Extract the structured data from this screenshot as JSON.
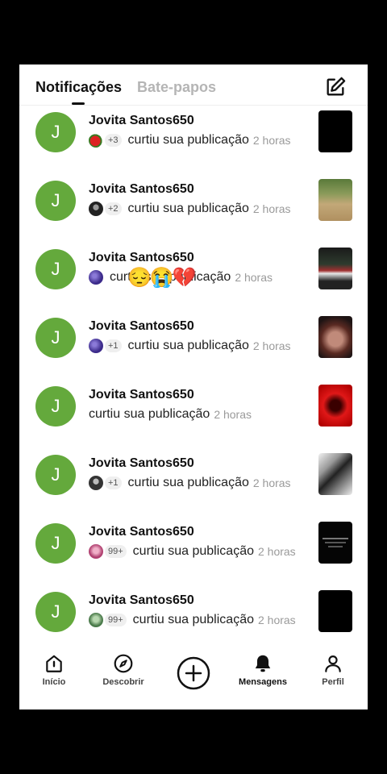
{
  "tabs": {
    "notifications": "Notificações",
    "chats": "Bate-papos"
  },
  "notifications": [
    {
      "name": "Jovita Santos650",
      "count": "+3",
      "action": "curtiu sua publicação",
      "time": "2 horas",
      "mini": "strawberry",
      "thumb": "#000000"
    },
    {
      "name": "Jovita Santos650",
      "count": "+2",
      "action": "curtiu sua publicação",
      "time": "2 horas",
      "mini": "dark-avatar",
      "thumb": "#9b8a5e"
    },
    {
      "name": "Jovita Santos650",
      "count": "",
      "action": "curtiu sua publicação",
      "time": "2 horas",
      "mini": "purple-avatar",
      "thumb": "#2a2a2a"
    },
    {
      "name": "Jovita Santos650",
      "count": "+1",
      "action": "curtiu sua publicação",
      "time": "2 horas",
      "mini": "purple-avatar",
      "thumb": "#4a2f2a"
    },
    {
      "name": "Jovita Santos650",
      "count": "",
      "action": "curtiu sua publicação",
      "time": "2 horas",
      "mini": "",
      "thumb": "#d81010"
    },
    {
      "name": "Jovita Santos650",
      "count": "+1",
      "action": "curtiu sua publicação",
      "time": "2 horas",
      "mini": "dark-avatar",
      "thumb": "#d9d9d9"
    },
    {
      "name": "Jovita Santos650",
      "count": "99+",
      "action": "curtiu sua publicação",
      "time": "2 horas",
      "mini": "pink-avatar",
      "thumb": "#050505"
    },
    {
      "name": "Jovita Santos650",
      "count": "99+",
      "action": "curtiu sua publicação",
      "time": "2 horas",
      "mini": "green-avatar",
      "thumb": "#000000"
    }
  ],
  "avatar_letter": "J",
  "overlay_emojis": "😔😭💔",
  "nav": {
    "home": "Início",
    "discover": "Descobrir",
    "messages": "Mensagens",
    "profile": "Perfil"
  },
  "colors": {
    "avatar": "#64a93c",
    "accent": "#111111"
  }
}
